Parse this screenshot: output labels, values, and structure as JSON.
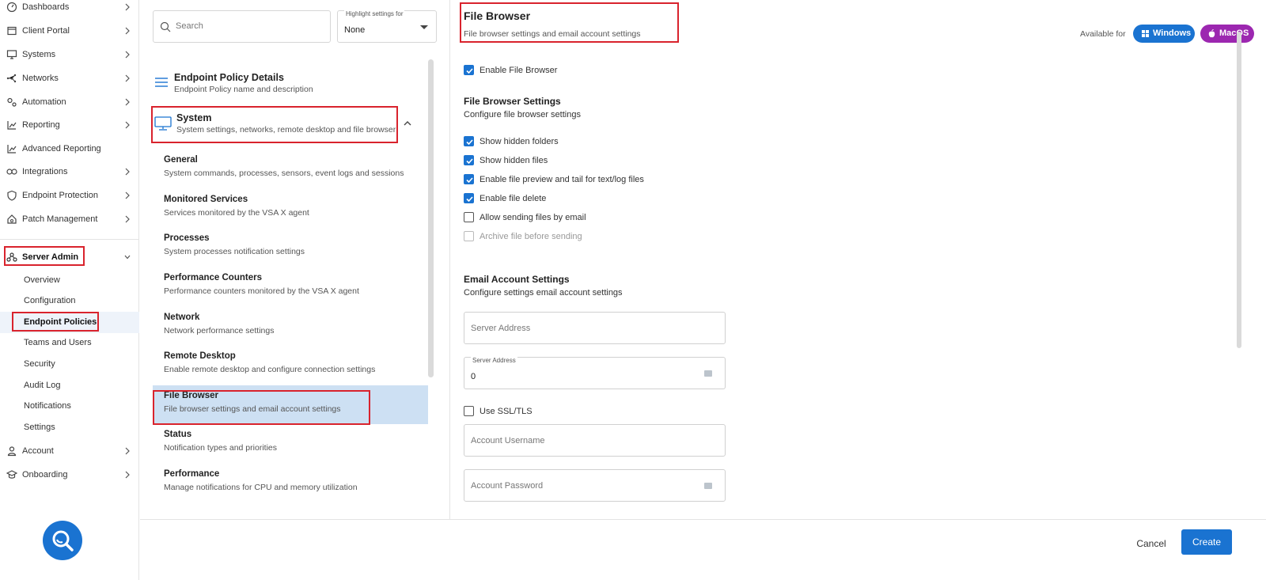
{
  "nav": {
    "items": [
      {
        "label": "Dashboards",
        "icon": "dashboard-icon"
      },
      {
        "label": "Client Portal",
        "icon": "portal-icon"
      },
      {
        "label": "Systems",
        "icon": "monitor-icon"
      },
      {
        "label": "Networks",
        "icon": "network-icon"
      },
      {
        "label": "Automation",
        "icon": "automation-icon"
      },
      {
        "label": "Reporting",
        "icon": "chart-icon"
      },
      {
        "label": "Advanced Reporting",
        "icon": "chart-icon"
      },
      {
        "label": "Integrations",
        "icon": "infinity-icon"
      },
      {
        "label": "Endpoint Protection",
        "icon": "shield-icon"
      },
      {
        "label": "Patch Management",
        "icon": "house-gear-icon"
      }
    ],
    "server_admin": {
      "label": "Server Admin",
      "icon": "server-icon",
      "subitems": [
        "Overview",
        "Configuration",
        "Endpoint Policies",
        "Teams and Users",
        "Security",
        "Audit Log",
        "Notifications",
        "Settings"
      ]
    },
    "bottom_items": [
      {
        "label": "Account",
        "icon": "user-icon"
      },
      {
        "label": "Onboarding",
        "icon": "graduation-cap-icon"
      }
    ]
  },
  "middle": {
    "search_placeholder": "Search",
    "highlight": {
      "caption": "Highlight settings for",
      "value": "None"
    },
    "policy_details": {
      "title": "Endpoint Policy Details",
      "desc": "Endpoint Policy name and description"
    },
    "system": {
      "title": "System",
      "desc": "System settings, networks, remote desktop and file browser"
    },
    "items": [
      {
        "title": "General",
        "desc": "System commands, processes, sensors, event logs and sessions"
      },
      {
        "title": "Monitored Services",
        "desc": "Services monitored by the VSA X agent"
      },
      {
        "title": "Processes",
        "desc": "System processes notification settings"
      },
      {
        "title": "Performance Counters",
        "desc": "Performance counters monitored by the VSA X agent"
      },
      {
        "title": "Network",
        "desc": "Network performance settings"
      },
      {
        "title": "Remote Desktop",
        "desc": "Enable remote desktop and configure connection settings"
      },
      {
        "title": "File Browser",
        "desc": "File browser settings and email account settings"
      },
      {
        "title": "Status",
        "desc": "Notification types and priorities"
      },
      {
        "title": "Performance",
        "desc": "Manage notifications for CPU and memory utilization"
      }
    ]
  },
  "right": {
    "title": "File Browser",
    "subtitle": "File browser settings and email account settings",
    "available_for": "Available for",
    "windows": "Windows",
    "macos": "MacOS",
    "enable_file_browser": "Enable File Browser",
    "fb_settings_title": "File Browser Settings",
    "fb_settings_desc": "Configure file browser settings",
    "options": [
      {
        "label": "Show hidden folders",
        "state": "checked"
      },
      {
        "label": "Show hidden files",
        "state": "checked"
      },
      {
        "label": "Enable file preview and tail for text/log files",
        "state": "checked"
      },
      {
        "label": "Enable file delete",
        "state": "checked"
      },
      {
        "label": "Allow sending files by email",
        "state": "unchecked"
      },
      {
        "label": "Archive file before sending",
        "state": "disabled"
      }
    ],
    "email_title": "Email Account Settings",
    "email_desc": "Configure settings email account settings",
    "server_address_placeholder": "Server Address",
    "port_caption": "Server Address",
    "port_value": "0",
    "use_ssl": "Use SSL/TLS",
    "username_placeholder": "Account Username",
    "password_placeholder": "Account Password"
  },
  "footer": {
    "cancel": "Cancel",
    "create": "Create"
  },
  "colors": {
    "accent": "#1a73d1",
    "macos": "#9c27b0",
    "highlight": "#d9232d",
    "selected": "#cde0f3"
  }
}
